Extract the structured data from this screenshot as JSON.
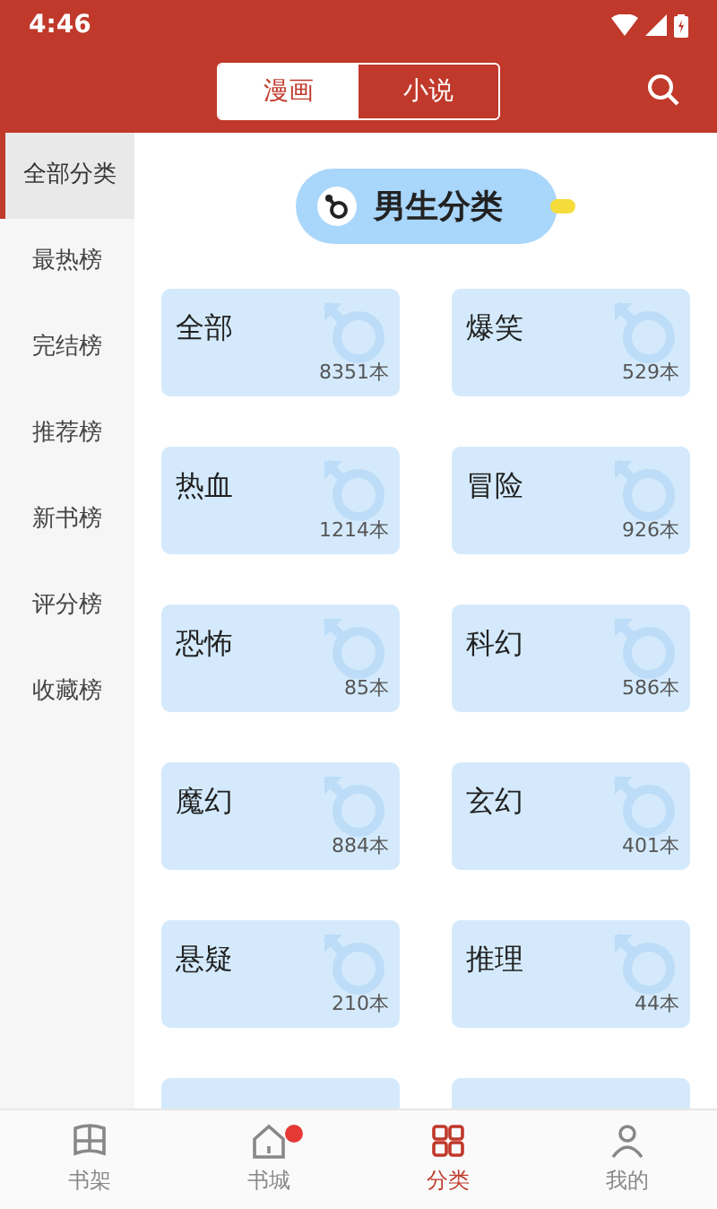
{
  "status_bar": {
    "time": "4:46"
  },
  "header": {
    "tabs": [
      {
        "label": "漫画",
        "selected": true
      },
      {
        "label": "小说",
        "selected": false
      }
    ]
  },
  "sidebar": {
    "items": [
      {
        "label": "全部分类",
        "selected": true
      },
      {
        "label": "最热榜",
        "selected": false
      },
      {
        "label": "完结榜",
        "selected": false
      },
      {
        "label": "推荐榜",
        "selected": false
      },
      {
        "label": "新书榜",
        "selected": false
      },
      {
        "label": "评分榜",
        "selected": false
      },
      {
        "label": "收藏榜",
        "selected": false
      }
    ]
  },
  "section": {
    "title": "男生分类"
  },
  "categories": [
    {
      "name": "全部",
      "count": "8351本"
    },
    {
      "name": "爆笑",
      "count": "529本"
    },
    {
      "name": "热血",
      "count": "1214本"
    },
    {
      "name": "冒险",
      "count": "926本"
    },
    {
      "name": "恐怖",
      "count": "85本"
    },
    {
      "name": "科幻",
      "count": "586本"
    },
    {
      "name": "魔幻",
      "count": "884本"
    },
    {
      "name": "玄幻",
      "count": "401本"
    },
    {
      "name": "悬疑",
      "count": "210本"
    },
    {
      "name": "推理",
      "count": "44本"
    }
  ],
  "bottom_nav": [
    {
      "label": "书架",
      "selected": false,
      "badge": false
    },
    {
      "label": "书城",
      "selected": false,
      "badge": true
    },
    {
      "label": "分类",
      "selected": true,
      "badge": false
    },
    {
      "label": "我的",
      "selected": false,
      "badge": false
    }
  ]
}
